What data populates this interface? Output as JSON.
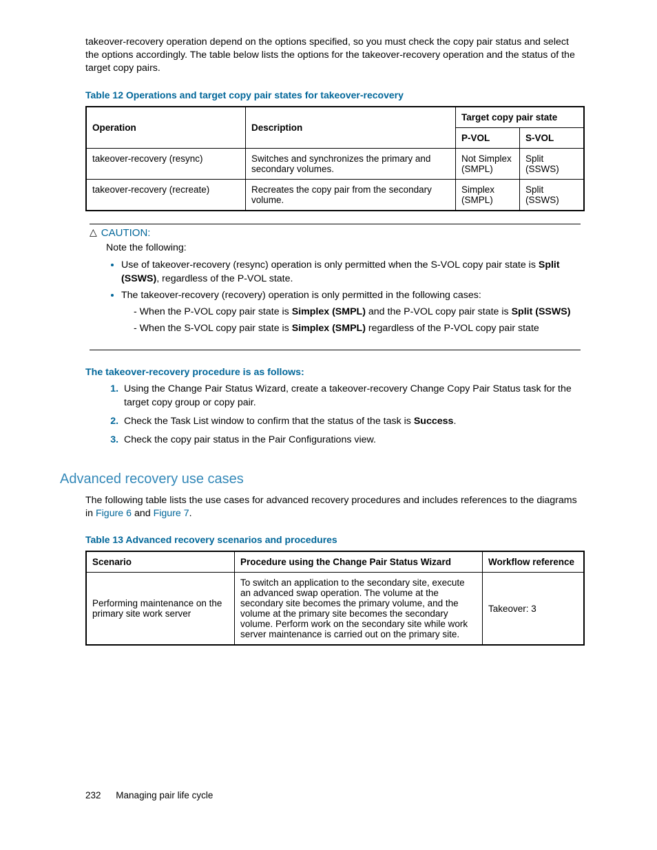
{
  "intro": "takeover-recovery operation depend on the options specified, so you must check the copy pair status and select the options accordingly. The table below lists the options for the takeover-recovery operation and the status of the target copy pairs.",
  "table12": {
    "caption": "Table 12 Operations and target copy pair states for takeover-recovery",
    "head": {
      "operation": "Operation",
      "description": "Description",
      "target": "Target copy pair state",
      "pvol": "P-VOL",
      "svol": "S-VOL"
    },
    "rows": [
      {
        "op": "takeover-recovery (resync)",
        "desc": "Switches and synchronizes the primary and secondary volumes.",
        "pvol": "Not Simplex (SMPL)",
        "svol": "Split (SSWS)"
      },
      {
        "op": "takeover-recovery (recreate)",
        "desc": "Recreates the copy pair from the secondary volume.",
        "pvol": "Simplex (SMPL)",
        "svol": "Split (SSWS)"
      }
    ]
  },
  "caution": {
    "label": "CAUTION:",
    "note": "Note the following:",
    "b1a": "Use of takeover-recovery (resync) operation is only permitted when the S-VOL copy pair state is ",
    "b1b": "Split (SSWS)",
    "b1c": ", regardless of the P-VOL state.",
    "b2": "The takeover-recovery (recovery) operation is only permitted in the following cases:",
    "s1a": "- When the P-VOL copy pair state is ",
    "s1b": "Simplex (SMPL)",
    "s1c": " and the P-VOL copy pair state is ",
    "s1d": "Split (SSWS)",
    "s2a": "- When the S-VOL copy pair state is ",
    "s2b": "Simplex (SMPL)",
    "s2c": " regardless of the P-VOL copy pair state"
  },
  "procedure": {
    "head": "The takeover-recovery procedure is as follows:",
    "s1": "Using the Change Pair Status Wizard, create a takeover-recovery Change Copy Pair Status task for the target copy group or copy pair.",
    "s2a": "Check the Task List window to confirm that the status of the task is ",
    "s2b": "Success",
    "s2c": ".",
    "s3": "Check the copy pair status in the Pair Configurations view."
  },
  "section": {
    "title": "Advanced recovery use cases",
    "p_a": "The following table lists the use cases for advanced recovery procedures and includes references to the diagrams in ",
    "fig6": "Figure 6",
    "p_b": " and ",
    "fig7": "Figure 7",
    "p_c": "."
  },
  "table13": {
    "caption": "Table 13 Advanced recovery scenarios and procedures",
    "head": {
      "scenario": "Scenario",
      "procedure": "Procedure using the Change Pair Status Wizard",
      "workflow": "Workflow reference"
    },
    "row1": {
      "scenario": "Performing maintenance on the primary site work server",
      "procedure": "To switch an application to the secondary site, execute an advanced swap operation. The volume at the secondary site becomes the primary volume, and the volume at the primary site becomes the secondary volume. Perform work on the secondary site while work server maintenance is carried out on the primary site.",
      "workflow": "Takeover: 3"
    }
  },
  "footer": {
    "page": "232",
    "title": "Managing pair life cycle"
  }
}
